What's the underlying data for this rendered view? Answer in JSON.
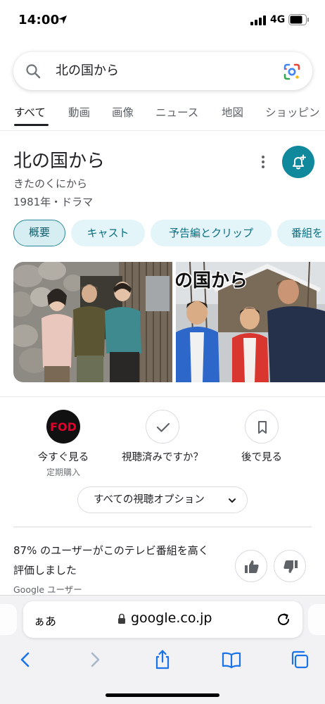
{
  "status_bar": {
    "time": "14:00",
    "network": "4G"
  },
  "search": {
    "query": "北の国から"
  },
  "tabs": [
    {
      "label": "すべて"
    },
    {
      "label": "動画"
    },
    {
      "label": "画像"
    },
    {
      "label": "ニュース"
    },
    {
      "label": "地図"
    },
    {
      "label": "ショッピン"
    }
  ],
  "knowledge_panel": {
    "title": "北の国から",
    "reading": "きたのくにから",
    "meta": "1981年・ドラマ",
    "chips": [
      {
        "label": "概要"
      },
      {
        "label": "キャスト"
      },
      {
        "label": "予告編とクリップ"
      },
      {
        "label": "番組を"
      }
    ],
    "image_overlay_text": "の国から"
  },
  "watch_options": [
    {
      "label": "今すぐ見る",
      "sub": "定期購入",
      "logo": "FOD"
    },
    {
      "label": "視聴済みですか？"
    },
    {
      "label": "後で見る"
    }
  ],
  "all_options_label": "すべての視聴オプション",
  "rating": {
    "text": "87% のユーザーがこのテレビ番組を高く評価しました",
    "source": "Google ユーザー"
  },
  "browser": {
    "aa": "ぁあ",
    "url": "google.co.jp"
  },
  "colors": {
    "accent": "#11899d",
    "chip_bg": "#e3f5f9",
    "fod_red": "#e4002b"
  }
}
